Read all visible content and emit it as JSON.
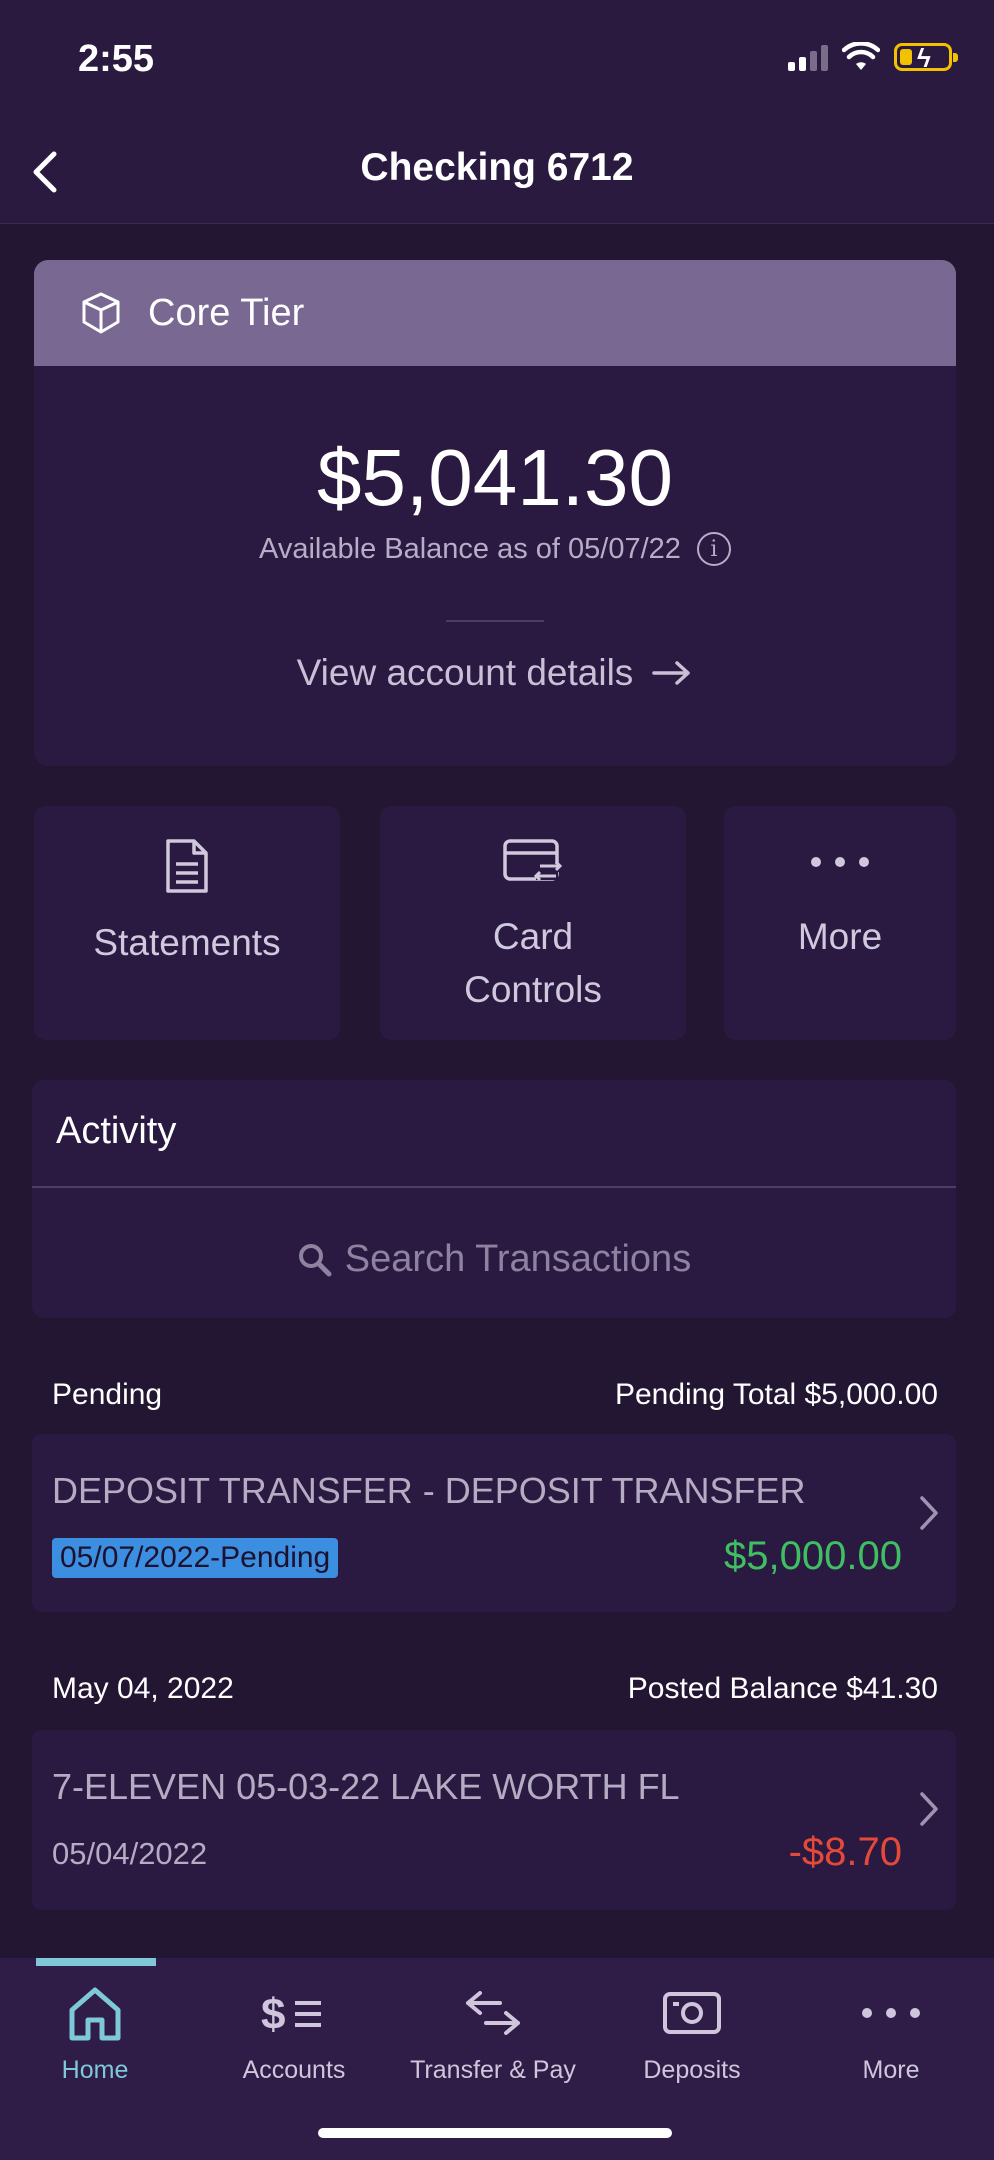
{
  "status": {
    "time": "2:55"
  },
  "header": {
    "title": "Checking 6712"
  },
  "account": {
    "tier": "Core Tier",
    "balance": "$5,041.30",
    "balance_caption": "Available Balance as of 05/07/22",
    "view_details": "View account details"
  },
  "actions": {
    "statements": "Statements",
    "card_controls_line1": "Card",
    "card_controls_line2": "Controls",
    "more": "More"
  },
  "activity": {
    "title": "Activity",
    "search_placeholder": "Search Transactions"
  },
  "groups": [
    {
      "label": "Pending",
      "total": "Pending Total $5,000.00",
      "transaction": {
        "description": "DEPOSIT TRANSFER - DEPOSIT TRANSFER",
        "date": "05/07/2022-Pending",
        "amount": "$5,000.00",
        "amount_color": "#3fbf62"
      }
    },
    {
      "label": "May 04, 2022",
      "total": "Posted Balance $41.30",
      "transaction": {
        "description": "7-ELEVEN 05-03-22 LAKE WORTH FL",
        "date": "05/04/2022",
        "amount": "-$8.70",
        "amount_color": "#e5493a"
      }
    }
  ],
  "tabs": [
    {
      "label": "Home",
      "icon": "home-icon",
      "active": true
    },
    {
      "label": "Accounts",
      "icon": "accounts-icon",
      "active": false
    },
    {
      "label": "Transfer & Pay",
      "icon": "transfer-icon",
      "active": false
    },
    {
      "label": "Deposits",
      "icon": "deposits-icon",
      "active": false
    },
    {
      "label": "More",
      "icon": "more-icon",
      "active": false
    }
  ],
  "colors": {
    "background": "#221633",
    "accent": "#7ec8d8",
    "tier_header": "#796892",
    "pending_badge": "#3b8ee0"
  }
}
